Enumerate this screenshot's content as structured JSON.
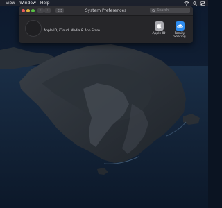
{
  "menubar": {
    "items": [
      "View",
      "Window",
      "Help"
    ],
    "status_icons": [
      "wifi-icon",
      "spotlight-search-icon",
      "control-center-icon"
    ]
  },
  "window": {
    "title": "System Preferences",
    "traffic_lights": [
      "close",
      "minimize",
      "zoom"
    ],
    "nav": {
      "back_glyph": "‹",
      "forward_glyph": "›"
    },
    "search": {
      "placeholder": "Search",
      "value": ""
    },
    "account": {
      "label": "Apple ID, iCloud, Media & App Store"
    },
    "preferences": [
      {
        "label": "Apple ID",
        "icon": "apple-logo-icon"
      },
      {
        "label": "Family Sharing",
        "icon": "family-sharing-icon"
      }
    ]
  },
  "colors": {
    "close": "#ec5f5a",
    "minimize": "#e0b33c",
    "zoom": "#59bf44",
    "window_bg": "#262629",
    "family_sharing": "#2d8cf0"
  }
}
